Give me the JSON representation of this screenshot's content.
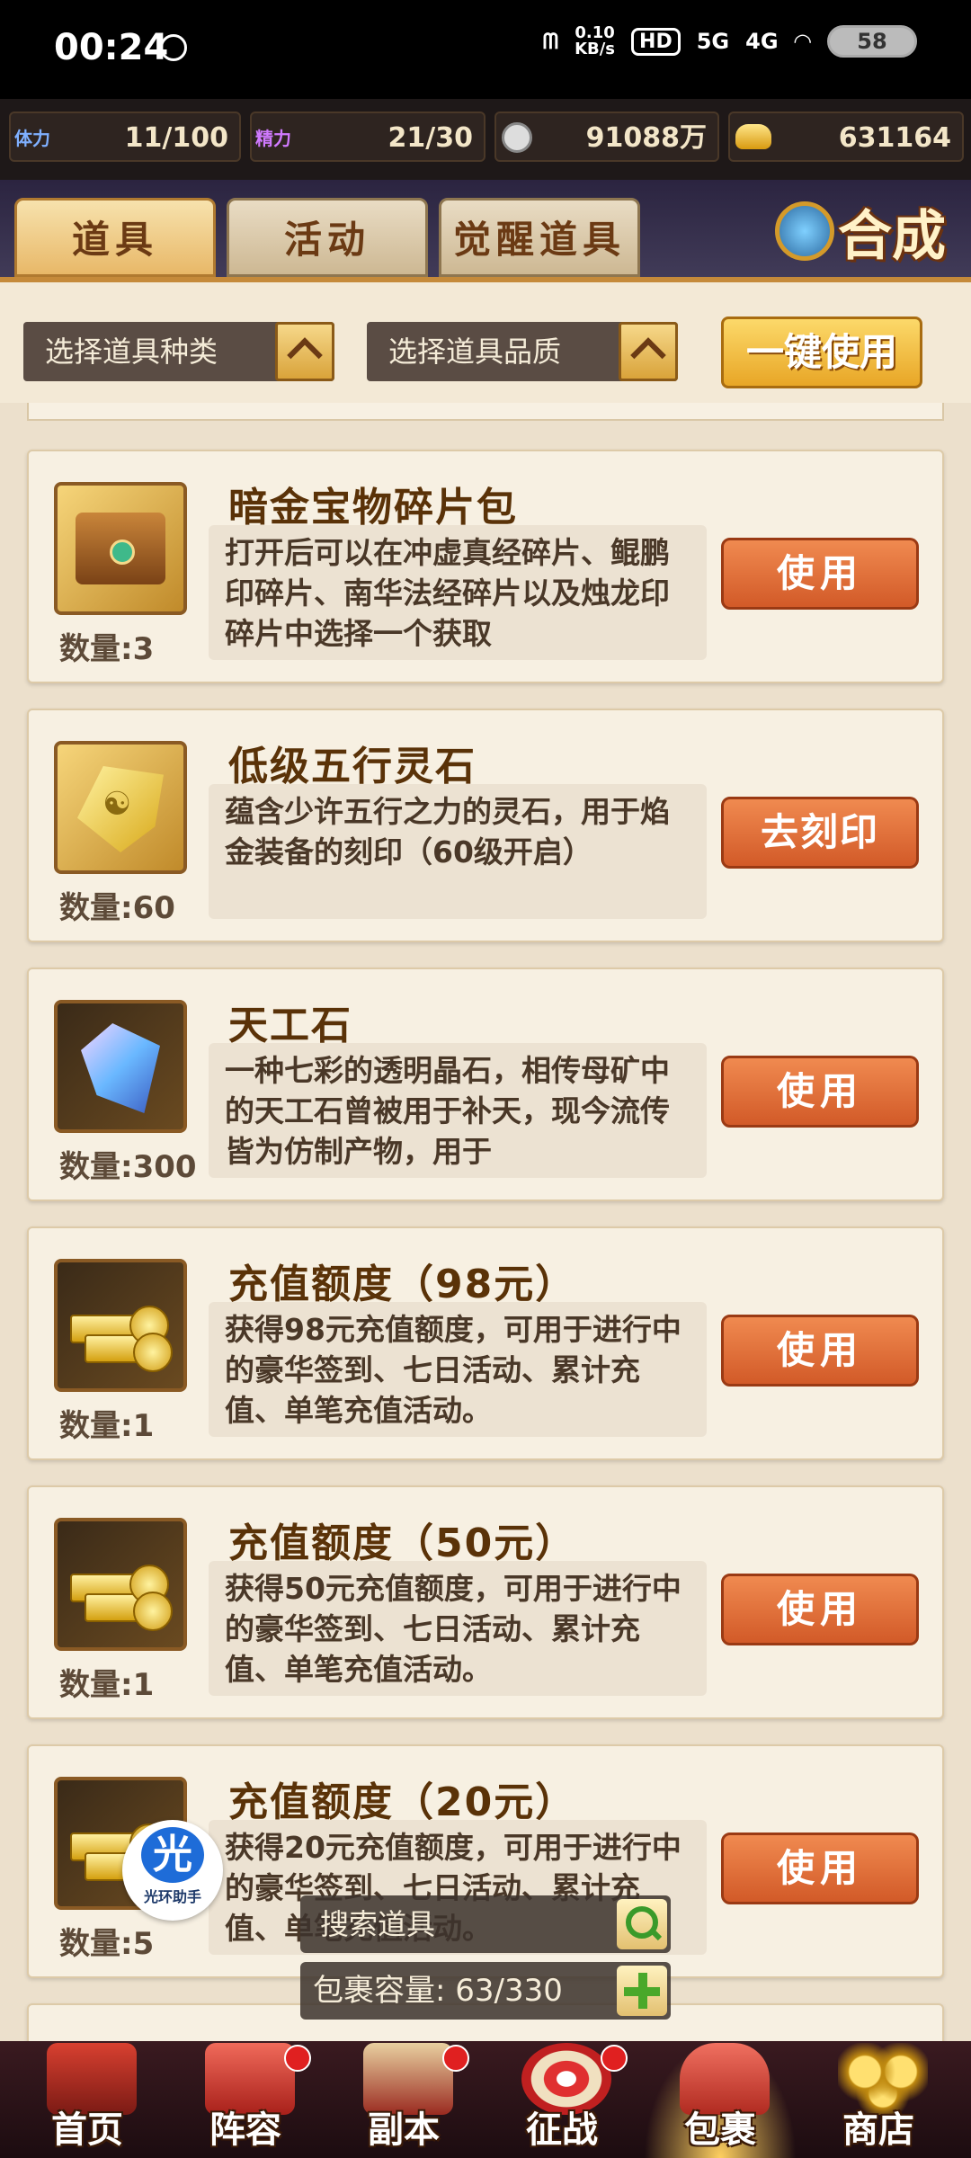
{
  "status_bar": {
    "time": "00:24",
    "net_speed_top": "0.10",
    "net_speed_bottom": "KB/s",
    "hd_label": "HD",
    "signal_5g": "5G",
    "signal_4g": "4G",
    "battery": "58"
  },
  "resources": {
    "stamina": {
      "label": "体力",
      "value": "11/100"
    },
    "energy": {
      "label": "精力",
      "value": "21/30"
    },
    "silver": {
      "value": "91088万"
    },
    "gold": {
      "value": "631164"
    }
  },
  "tabs": [
    {
      "label": "道具",
      "active": true
    },
    {
      "label": "活动",
      "active": false
    },
    {
      "label": "觉醒道具",
      "active": false
    }
  ],
  "compose_label": "合成",
  "filters": {
    "type_label": "选择道具种类",
    "quality_label": "选择道具品质",
    "one_key_use": "一键使用"
  },
  "items": [
    {
      "name": "暗金宝物碎片包",
      "qty": "数量:3",
      "desc": "打开后可以在冲虚真经碎片、鲲鹏印碎片、南华法经碎片以及烛龙印碎片中选择一个获取",
      "button": "使用",
      "art": "chest-icon"
    },
    {
      "name": "低级五行灵石",
      "qty": "数量:60",
      "desc": "蕴含少许五行之力的灵石，用于焰金装备的刻印（60级开启）",
      "button": "去刻印",
      "art": "spirit-stone-icon"
    },
    {
      "name": "天工石",
      "qty": "数量:300",
      "desc": "一种七彩的透明晶石，相传母矿中的天工石曾被用于补天，现今流传皆为仿制产物，用于",
      "button": "使用",
      "art": "crystal-icon"
    },
    {
      "name": "充值额度（98元）",
      "qty": "数量:1",
      "desc": "获得98元充值额度，可用于进行中的豪华签到、七日活动、累计充值、单笔充值活动。",
      "button": "使用",
      "art": "gold-bars-icon"
    },
    {
      "name": "充值额度（50元）",
      "qty": "数量:1",
      "desc": "获得50元充值额度，可用于进行中的豪华签到、七日活动、累计充值、单笔充值活动。",
      "button": "使用",
      "art": "gold-bars-icon"
    },
    {
      "name": "充值额度（20元）",
      "qty": "数量:5",
      "desc": "获得20元充值额度，可用于进行中的豪华签到、七日活动、累计充值、单笔充值活动。",
      "button": "使用",
      "art": "gold-bars-icon"
    }
  ],
  "assistant": {
    "glyph": "光",
    "label": "光环助手"
  },
  "search": {
    "label": "搜索道具"
  },
  "bag": {
    "label": "包裹容量:",
    "value": "63/330"
  },
  "nav": [
    {
      "label": "首页",
      "active": false,
      "dot": false
    },
    {
      "label": "阵容",
      "active": false,
      "dot": true
    },
    {
      "label": "副本",
      "active": false,
      "dot": true
    },
    {
      "label": "征战",
      "active": false,
      "dot": true
    },
    {
      "label": "包裹",
      "active": true,
      "dot": false
    },
    {
      "label": "商店",
      "active": false,
      "dot": false
    }
  ]
}
